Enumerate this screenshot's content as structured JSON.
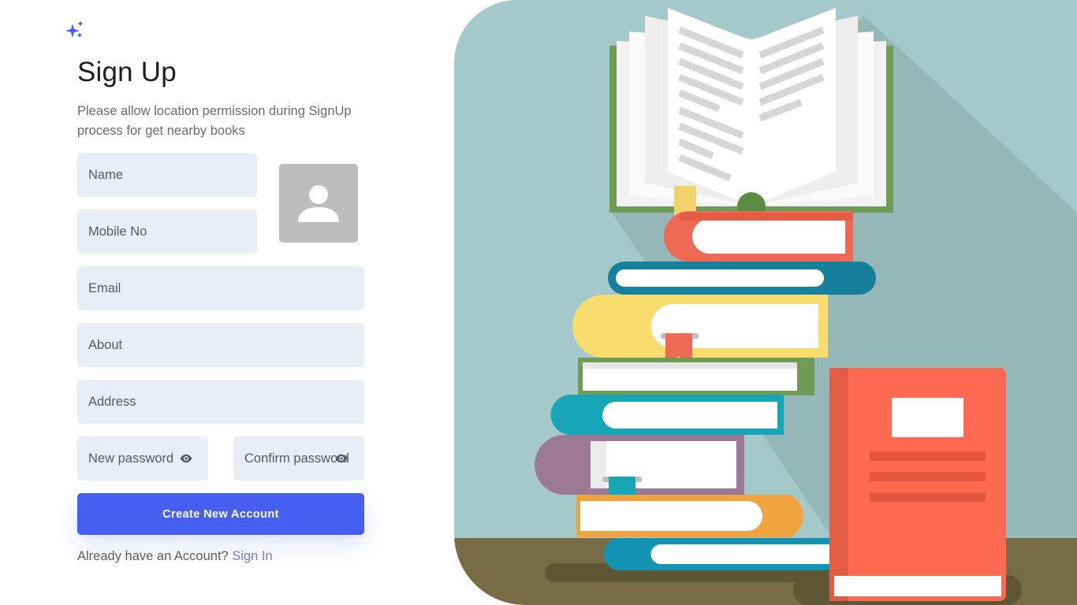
{
  "brand": {
    "logo_icon": "sparkle-icon",
    "accent": "#465ff0"
  },
  "header": {
    "title": "Sign Up",
    "subtitle": "Please allow location permission during SignUp process for get nearby books"
  },
  "form": {
    "name_placeholder": "Name",
    "mobile_placeholder": "Mobile No",
    "email_placeholder": "Email",
    "about_placeholder": "About",
    "address_placeholder": "Address",
    "new_password_placeholder": "New password",
    "confirm_password_placeholder": "Confirm password",
    "password_toggle_icon": "eye-icon",
    "avatar_icon": "user-icon",
    "submit_label": "Create New Account"
  },
  "footer": {
    "prompt": "Already have an Account?",
    "link_label": "Sign In"
  },
  "colors": {
    "field_bg": "#e8edf6",
    "illustration_bg": "#a5c9ca",
    "floor": "#776c45"
  }
}
